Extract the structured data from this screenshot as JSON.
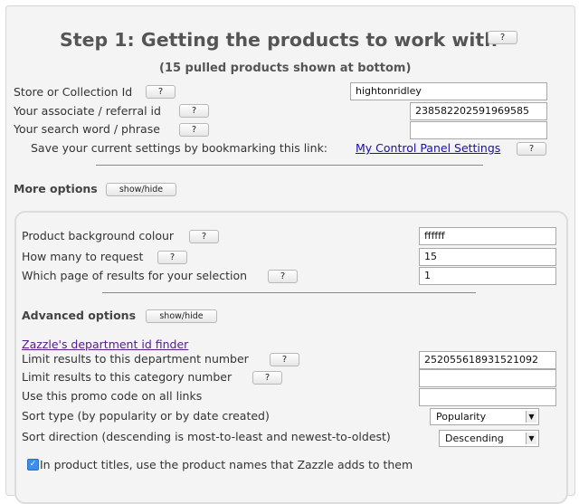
{
  "step": {
    "title": "Step 1: Getting the products to work with",
    "subtitle": "(15 pulled products shown at bottom)",
    "help": "?"
  },
  "fields": {
    "store": {
      "label": "Store or Collection Id",
      "value": "hightonridley"
    },
    "associate": {
      "label": "Your associate / referral id",
      "value": "238582202591969585"
    },
    "search": {
      "label": "Your search word / phrase",
      "value": ""
    }
  },
  "bookmark": {
    "text": "Save your current settings by bookmarking this link:",
    "link": "My Control Panel Settings"
  },
  "more_options": {
    "title": "More options",
    "toggle": "show/hide"
  },
  "options": {
    "bg_colour": {
      "label": "Product background colour",
      "value": "ffffff"
    },
    "how_many": {
      "label": "How many to request",
      "value": "15"
    },
    "which_page": {
      "label": "Which page of results for your selection",
      "value": "1"
    }
  },
  "advanced": {
    "title": "Advanced options",
    "toggle": "show/hide",
    "dept_finder": "Zazzle's department id finder",
    "dept_number": {
      "label": "Limit results to this department number",
      "value": "252055618931521092"
    },
    "category_number": {
      "label": "Limit results to this category number",
      "value": ""
    },
    "promo_code": {
      "label": "Use this promo code on all links",
      "value": ""
    },
    "sort_type": {
      "label": "Sort type (by popularity or by date created)",
      "value": "Popularity"
    },
    "sort_direction": {
      "label": "Sort direction (descending is most-to-least and newest-to-oldest)",
      "value": "Descending"
    },
    "product_titles": {
      "label": "In product titles, use the product names that Zazzle adds to them",
      "checked": true
    }
  }
}
